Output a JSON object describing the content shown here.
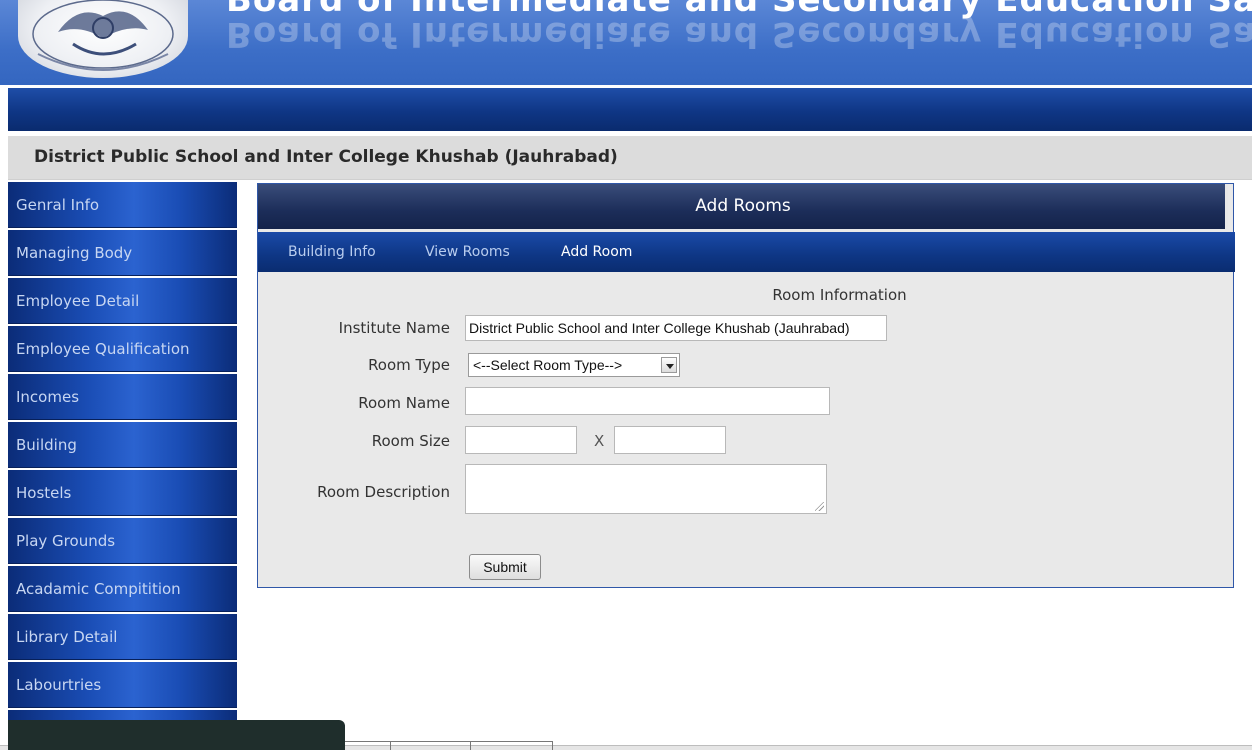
{
  "header": {
    "banner_title": "Board of Intermediate and Secondary Education Sargodha",
    "logo_name": "bise-sargodha-logo"
  },
  "school": {
    "title": "District Public School and Inter College Khushab (Jauhrabad)"
  },
  "sidebar": {
    "items": [
      {
        "label": "Genral Info"
      },
      {
        "label": "Managing Body"
      },
      {
        "label": "Employee Detail"
      },
      {
        "label": "Employee Qualification"
      },
      {
        "label": "Incomes"
      },
      {
        "label": "Building"
      },
      {
        "label": "Hostels"
      },
      {
        "label": "Play Grounds"
      },
      {
        "label": "Acadamic Compitition"
      },
      {
        "label": "Library Detail"
      },
      {
        "label": "Labourtries"
      }
    ]
  },
  "panel": {
    "title": "Add Rooms",
    "tabs": [
      {
        "label": "Building Info"
      },
      {
        "label": "View Rooms"
      },
      {
        "label": "Add Room"
      }
    ],
    "section_title": "Room Information"
  },
  "form": {
    "institute_name_label": "Institute Name",
    "institute_name_value": "District Public School and Inter College Khushab (Jauhrabad)",
    "room_type_label": "Room Type",
    "room_type_selected": "<--Select Room Type-->",
    "room_name_label": "Room Name",
    "room_name_value": "",
    "room_size_label": "Room Size",
    "room_size_sep": "X",
    "room_description_label": "Room Description",
    "submit_label": "Submit"
  },
  "colors": {
    "header_blue": "#3c6ec7",
    "nav_blue": "#0f3685",
    "panel_header": "#1c2d59"
  }
}
